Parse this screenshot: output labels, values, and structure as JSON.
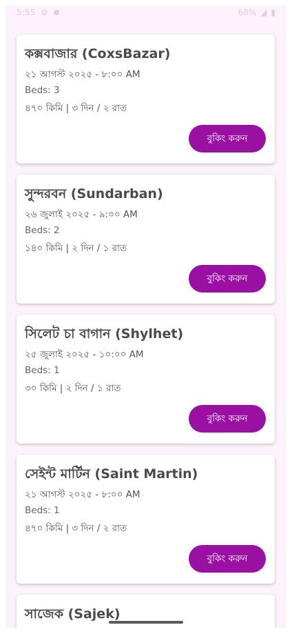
{
  "status_bar": {
    "time": "5:55",
    "battery": "68%"
  },
  "trips": [
    {
      "title": "কক্সবাজার (CoxsBazar)",
      "date": "২১ আগস্ট ২০২৫ - ৮:০০ AM",
      "beds": "Beds: 3",
      "trip_info": "৪৭০ কিমি | ৩ দিন / ২ রাত",
      "button_label": "বুকিং করুন"
    },
    {
      "title": "সুন্দরবন (Sundarban)",
      "date": "২৬ জুলাই ২০২৫ - ৯:০০ AM",
      "beds": "Beds: 2",
      "trip_info": "১৪০ কিমি | ২ দিন / ১ রাত",
      "button_label": "বুকিং করুন"
    },
    {
      "title": "সিলেট চা বাগান (Shylhet)",
      "date": "২৫ জুলাই ২০২৫ - ১০:০০ AM",
      "beds": "Beds: 1",
      "trip_info": "৩০ কিমি | ২ দিন / ১ রাত",
      "button_label": "বুকিং করুন"
    },
    {
      "title": "সেইন্ট মার্টিন (Saint Martin)",
      "date": "২১ আগস্ট ২০২৫ - ৮:০০ AM",
      "beds": "Beds: 1",
      "trip_info": "৪৭০ কিমি | ৩ দিন / ২ রাত",
      "button_label": "বুকিং করুন"
    },
    {
      "title": "সাজেক (Sajek)"
    }
  ],
  "colors": {
    "accent": "#9a10a3",
    "background": "#fcf2fb"
  }
}
